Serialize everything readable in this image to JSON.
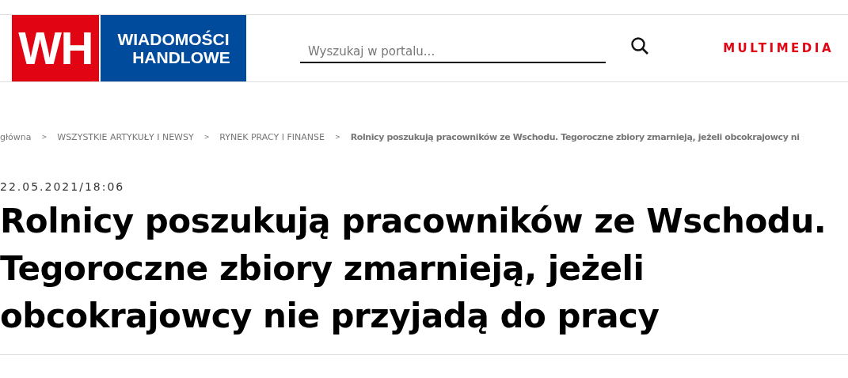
{
  "logo": {
    "mark": "WH",
    "name_line_1": "WIADOMOŚCI",
    "name_line_2": "HANDLOWE"
  },
  "search": {
    "placeholder": "Wyszukaj w portalu..."
  },
  "nav": [
    {
      "label": "MULTIMEDIA"
    }
  ],
  "breadcrumb": [
    {
      "label": "główna",
      "current": false
    },
    {
      "label": "WSZYSTKIE ARTYKUŁY I NEWSY",
      "current": false
    },
    {
      "label": "RYNEK PRACY I FINANSE",
      "current": false
    },
    {
      "label": "Rolnicy poszukują pracowników ze Wschodu. Tegoroczne zbiory zmarnieją, jeżeli obcokrajowcy ni",
      "current": true
    }
  ],
  "breadcrumb_separator": ">",
  "article": {
    "date": "22.05.2021/18:06",
    "title_lines": [
      "Rolnicy poszukują pracowników ze Wschodu.",
      "Tegoroczne zbiory zmarnieją, jeżeli",
      "obcokrajowcy nie przyjadą do pracy"
    ]
  }
}
